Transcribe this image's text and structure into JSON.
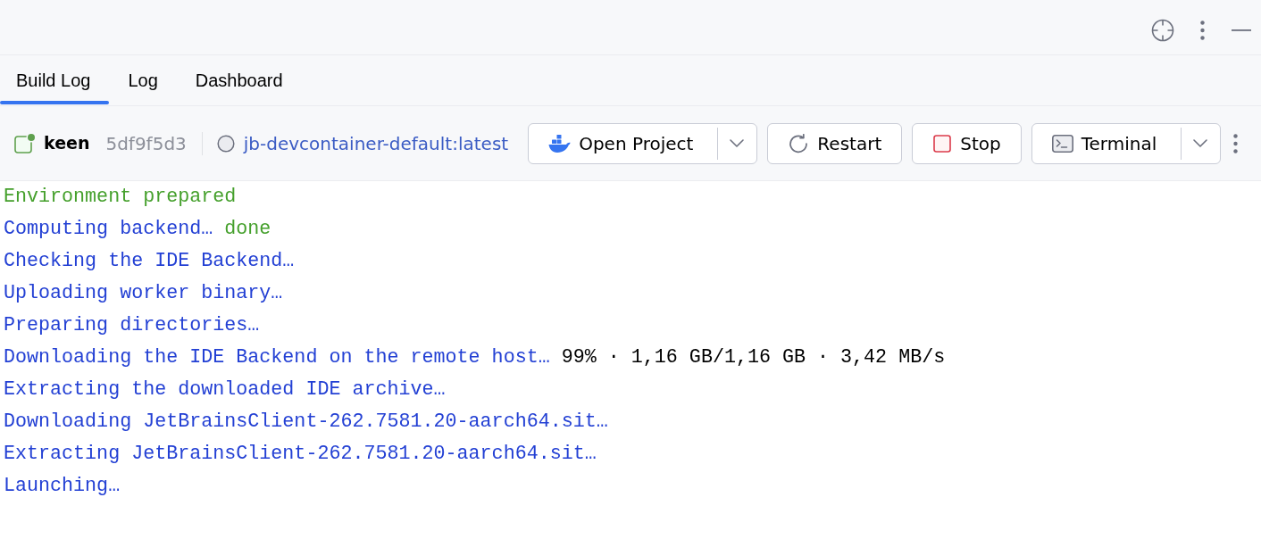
{
  "tabs": [
    {
      "label": "Build Log",
      "selected": true
    },
    {
      "label": "Log",
      "selected": false
    },
    {
      "label": "Dashboard",
      "selected": false
    }
  ],
  "container": {
    "name": "keen",
    "id": "5df9f5d3",
    "running": true,
    "image": "jb-devcontainer-default:latest"
  },
  "actions": [
    {
      "kind": "open",
      "label": "Open Project",
      "dropdown": true
    },
    {
      "kind": "restart",
      "label": "Restart",
      "dropdown": false
    },
    {
      "kind": "stop",
      "label": "Stop",
      "dropdown": false
    },
    {
      "kind": "terminal",
      "label": "Terminal",
      "dropdown": true
    }
  ],
  "log": [
    {
      "segments": [
        {
          "kind": "success",
          "text": "Environment prepared"
        }
      ]
    },
    {
      "segments": [
        {
          "kind": "info",
          "text": "Computing backend…"
        },
        {
          "kind": "success",
          "text": "done"
        }
      ]
    },
    {
      "segments": [
        {
          "kind": "info",
          "text": "Checking the IDE Backend…"
        }
      ]
    },
    {
      "segments": [
        {
          "kind": "info",
          "text": "Uploading worker binary…"
        }
      ]
    },
    {
      "segments": [
        {
          "kind": "info",
          "text": "Preparing directories…"
        }
      ]
    },
    {
      "segments": [
        {
          "kind": "info",
          "text": "Downloading the IDE Backend on the remote host…"
        },
        {
          "kind": "plain",
          "text": "99% · 1,16 GB/1,16 GB · 3,42 MB/s"
        }
      ]
    },
    {
      "segments": [
        {
          "kind": "info",
          "text": "Extracting the downloaded IDE archive…"
        }
      ]
    },
    {
      "segments": [
        {
          "kind": "info",
          "text": "Downloading JetBrainsClient-262.7581.20-aarch64.sit…"
        }
      ]
    },
    {
      "segments": [
        {
          "kind": "info",
          "text": "Extracting JetBrainsClient-262.7581.20-aarch64.sit…"
        }
      ]
    },
    {
      "segments": [
        {
          "kind": "info",
          "text": "Launching…"
        }
      ]
    }
  ]
}
